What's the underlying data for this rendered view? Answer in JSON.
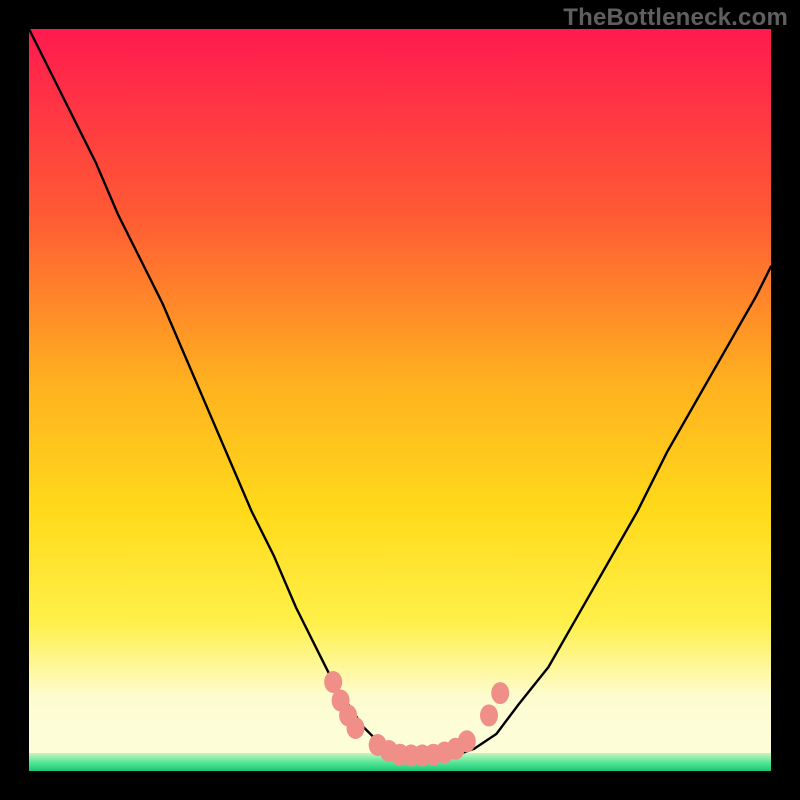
{
  "watermark": "TheBottleneck.com",
  "chart_data": {
    "type": "line",
    "title": "",
    "xlabel": "",
    "ylabel": "",
    "xlim": [
      0,
      100
    ],
    "ylim": [
      0,
      100
    ],
    "grid": false,
    "background_gradient": {
      "top": "#ff1a4f",
      "mid1": "#ff7a2a",
      "mid2": "#ffd21f",
      "mid3": "#fff37a",
      "bottom_band": "#fdfed8",
      "baseline": "#26df88"
    },
    "series": [
      {
        "name": "curve",
        "color": "#000000",
        "x": [
          0,
          3,
          6,
          9,
          12,
          15,
          18,
          21,
          24,
          27,
          30,
          33,
          36,
          39,
          41,
          43,
          45,
          47,
          49,
          51,
          53,
          56,
          58,
          60,
          63,
          66,
          70,
          74,
          78,
          82,
          86,
          90,
          94,
          98,
          100
        ],
        "y": [
          100,
          94,
          88,
          82,
          75,
          69,
          63,
          56,
          49,
          42,
          35,
          29,
          22,
          16,
          12,
          9,
          6,
          4,
          3,
          2.3,
          2.1,
          2.1,
          2.3,
          3,
          5,
          9,
          14,
          21,
          28,
          35,
          43,
          50,
          57,
          64,
          68
        ]
      }
    ],
    "highlight_points": {
      "color": "#f08f88",
      "points": [
        {
          "x": 41.0,
          "y": 12.0
        },
        {
          "x": 42.0,
          "y": 9.5
        },
        {
          "x": 43.0,
          "y": 7.5
        },
        {
          "x": 44.0,
          "y": 5.8
        },
        {
          "x": 47.0,
          "y": 3.5
        },
        {
          "x": 48.5,
          "y": 2.7
        },
        {
          "x": 50.0,
          "y": 2.2
        },
        {
          "x": 51.5,
          "y": 2.1
        },
        {
          "x": 53.0,
          "y": 2.1
        },
        {
          "x": 54.5,
          "y": 2.2
        },
        {
          "x": 56.0,
          "y": 2.5
        },
        {
          "x": 57.5,
          "y": 3.0
        },
        {
          "x": 59.0,
          "y": 4.0
        },
        {
          "x": 62.0,
          "y": 7.5
        },
        {
          "x": 63.5,
          "y": 10.5
        }
      ]
    }
  }
}
